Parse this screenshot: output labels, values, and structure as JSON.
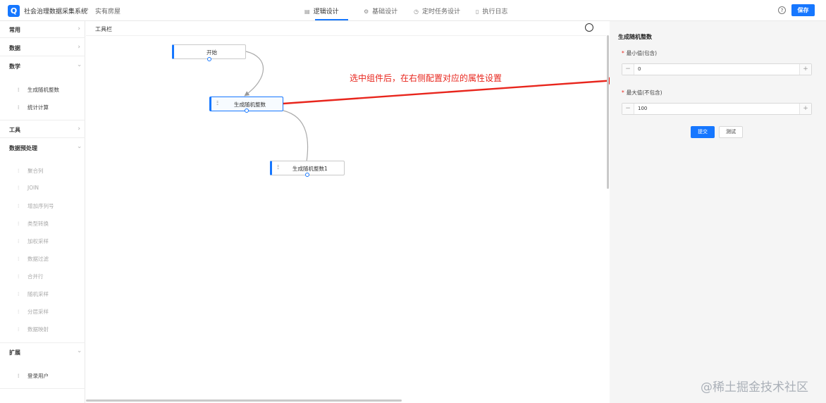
{
  "header": {
    "app_title": "社会治理数据采集系统",
    "breadcrumb_sep": "›",
    "breadcrumb": "实有房屋",
    "tabs": [
      {
        "icon": "document-icon",
        "label": "逻辑设计",
        "active": true
      },
      {
        "icon": "gear-icon",
        "label": "基础设计",
        "active": false
      },
      {
        "icon": "clock-icon",
        "label": "定时任务设计",
        "active": false
      },
      {
        "icon": "file-icon",
        "label": "执行日志",
        "active": false
      }
    ],
    "help_icon": "?",
    "save_label": "保存"
  },
  "sidebar": {
    "categories": [
      {
        "label": "常用",
        "expanded": false
      },
      {
        "label": "数据",
        "expanded": false
      },
      {
        "label": "数学",
        "expanded": true,
        "items": [
          "生成随机整数",
          "统计计算"
        ]
      },
      {
        "label": "工具",
        "expanded": false
      },
      {
        "label": "数据预处理",
        "expanded": true,
        "items": [
          "聚合列",
          "JOIN",
          "增加序列号",
          "类型转换",
          "加权采样",
          "数据过滤",
          "合并行",
          "随机采样",
          "分层采样",
          "数据映射"
        ]
      },
      {
        "label": "扩展",
        "expanded": true,
        "items": [
          "登录用户"
        ]
      }
    ],
    "item_icon": "sliders-icon"
  },
  "canvas": {
    "toolbar_label": "工具栏",
    "nodes": [
      {
        "label": "开始"
      },
      {
        "label": "生成随机整数",
        "selected": true
      },
      {
        "label": "生成随机整数1"
      }
    ],
    "annotation": "选中组件后，在右侧配置对应的属性设置"
  },
  "panel": {
    "title": "生成随机整数",
    "fields": [
      {
        "label": "最小值(包含)",
        "value": "0"
      },
      {
        "label": "最大值(不包含)",
        "value": "100"
      }
    ],
    "submit_label": "提交",
    "test_label": "测试"
  },
  "watermark": "@稀土掘金技术社区",
  "colors": {
    "accent": "#1677ff",
    "annotation": "#e8261d",
    "panel_bg": "#f5f5f5"
  }
}
